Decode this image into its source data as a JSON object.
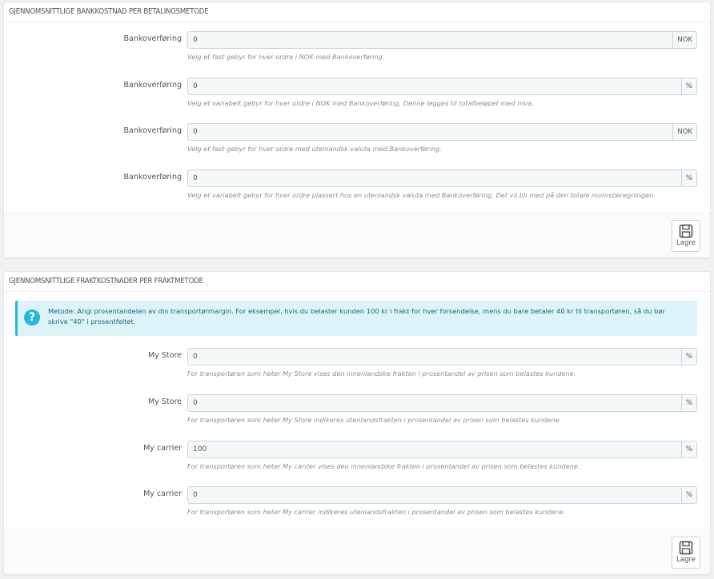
{
  "bank": {
    "title": "GJENNOMSNITTLIGE BANKKOSTNAD PER BETALINGSMETODE",
    "rows": [
      {
        "label": "Bankoverføring",
        "value": "0",
        "unit": "NOK",
        "help": "Velg et fast gebyr for hver ordre i NOK med Bankoverføring."
      },
      {
        "label": "Bankoverføring",
        "value": "0",
        "unit": "%",
        "help": "Velg et variabelt gebyr for hver ordre i NOK med Bankoverføring. Denne legges til totalbeløpet med mva."
      },
      {
        "label": "Bankoverføring",
        "value": "0",
        "unit": "NOK",
        "help": "Velg et fast gebyr for hver ordre med utenlandsk valuta med Bankoverføring."
      },
      {
        "label": "Bankoverføring",
        "value": "0",
        "unit": "%",
        "help": "Velg et variabelt gebyr for hver ordre plassert hos en utenlandsk valuta med Bankoverføring. Det vil bli med på den totale momsberegningen."
      }
    ],
    "save_label": "Lagre"
  },
  "shipping": {
    "title": "GJENNOMSNITTLIGE FRAKTKOSTNADER PER FRAKTMETODE",
    "info_icon": "question-circle-icon",
    "info": "Metode: Angi prosentandelen av din transportørmargin. For eksempel, hvis du belaster kunden 100 kr i frakt for hver forsendelse, mens du bare betaler 40 kr til transportøren, så du bør skrive \"40\" i prosentfeltet.",
    "rows": [
      {
        "label": "My Store",
        "value": "0",
        "unit": "%",
        "help": "For transportøren som heter My Store vises den innenlandske frakten i prosentandel av prisen som belastes kundene."
      },
      {
        "label": "My Store",
        "value": "0",
        "unit": "%",
        "help": "For transportøren som heter My Store indikeres utenlandsfrakten i prosentandel av prisen som belastes kundene."
      },
      {
        "label": "My carrier",
        "value": "100",
        "unit": "%",
        "help": "For transportøren som heter My carrier vises den innenlandske frakten i prosentandel av prisen som belastes kundene."
      },
      {
        "label": "My carrier",
        "value": "0",
        "unit": "%",
        "help": "For transportøren som heter My carrier indikeres utenlandsfrakten i prosentandel av prisen som belastes kundene."
      }
    ],
    "save_label": "Lagre"
  },
  "colors": {
    "accent": "#25b9d7",
    "alert_bg": "#dcf4f9",
    "page_bg": "#eff1f2"
  }
}
